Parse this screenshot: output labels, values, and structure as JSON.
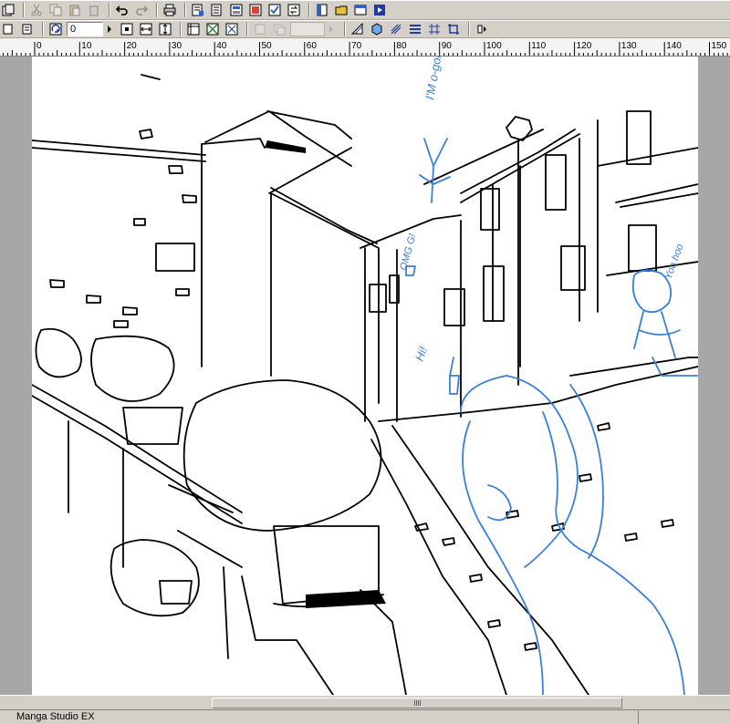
{
  "toolbar_main": {
    "icons": [
      "new-page-icon",
      "cut-icon",
      "copy-icon",
      "paste-icon",
      "delete-icon",
      "undo-icon",
      "redo-icon",
      "print-icon",
      "page-settings-icon",
      "layer-settings-icon",
      "layers-icon",
      "story-icon",
      "check-icon",
      "convert-icon",
      "page-icon",
      "folder-icon",
      "play-icon"
    ]
  },
  "toolbar_secondary": {
    "angle_value": "0"
  },
  "ruler": {
    "labels": [
      "0",
      "10",
      "20",
      "30",
      "40",
      "50",
      "60",
      "70",
      "80",
      "90",
      "100",
      "110",
      "120",
      "130",
      "140",
      "150"
    ]
  },
  "canvas": {
    "sketch_notes": {
      "top": "I'M o-gonna Jump!",
      "left": "OMG G!",
      "middle": "Hi!",
      "right": "Yoo hoo"
    },
    "line_color": "#000000",
    "sketch_color": "#3b7fd9"
  },
  "status": {
    "app_name": "Manga Studio EX"
  },
  "colors": {
    "chrome": "#d4d0c8",
    "workspace": "#a7a7a7"
  }
}
